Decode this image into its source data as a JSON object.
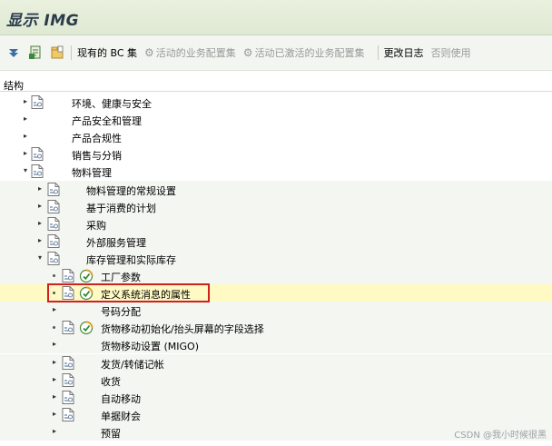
{
  "window": {
    "title": "显示 IMG"
  },
  "toolbar": {
    "existing_bc_sets": "现有的 BC 集",
    "activated_bc_sets": "活动的业务配置集",
    "changed_bc_sets": "活动已激活的业务配置集",
    "change_log": "更改日志",
    "otherwise_use": "否则使用"
  },
  "structure_label": "结构",
  "tree": [
    {
      "label": "环境、健康与安全",
      "arrow": "▸",
      "doc": true
    },
    {
      "label": "产品安全和管理",
      "arrow": "▸",
      "doc": false
    },
    {
      "label": "产品合规性",
      "arrow": "▸",
      "doc": false
    },
    {
      "label": "销售与分销",
      "arrow": "▸",
      "doc": true
    },
    {
      "label": "物料管理",
      "arrow": "▾",
      "doc": true
    },
    {
      "label": "物料管理的常规设置",
      "arrow": "▸",
      "doc": true
    },
    {
      "label": "基于消费的计划",
      "arrow": "▸",
      "doc": true
    },
    {
      "label": "采购",
      "arrow": "▸",
      "doc": true
    },
    {
      "label": "外部服务管理",
      "arrow": "▸",
      "doc": true
    },
    {
      "label": "库存管理和实际库存",
      "arrow": "▾",
      "doc": true
    },
    {
      "label": "工厂参数",
      "arrow": "•",
      "doc": true,
      "activity": true
    },
    {
      "label": "定义系统消息的属性",
      "arrow": "•",
      "doc": true,
      "activity": true,
      "selected": true
    },
    {
      "label": "号码分配",
      "arrow": "▸",
      "doc": false
    },
    {
      "label": "货物移动初始化/抬头屏幕的字段选择",
      "arrow": "•",
      "doc": true,
      "activity": true
    },
    {
      "label": "货物移动设置 (MIGO)",
      "arrow": "▸",
      "doc": false
    },
    {
      "label": "发货/转储记帐",
      "arrow": "▸",
      "doc": true
    },
    {
      "label": "收货",
      "arrow": "▸",
      "doc": true
    },
    {
      "label": "自动移动",
      "arrow": "▸",
      "doc": true
    },
    {
      "label": "单据财会",
      "arrow": "▸",
      "doc": true
    },
    {
      "label": "预留",
      "arrow": "▸",
      "doc": false
    }
  ],
  "watermark": "CSDN @我小时候很黑"
}
